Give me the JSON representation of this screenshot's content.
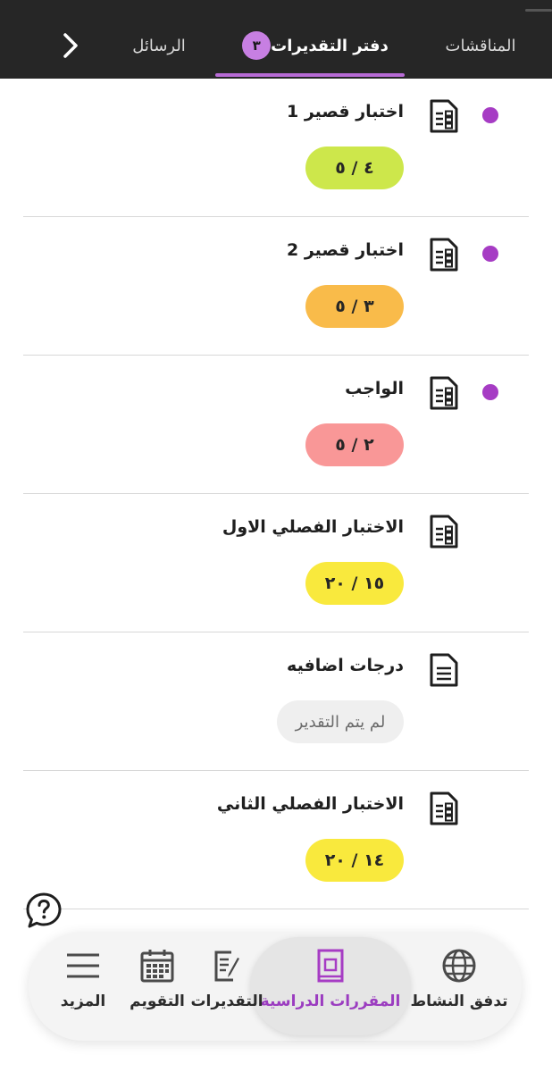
{
  "tabs": {
    "discussions": "المناقشات",
    "gradebook": "دفتر التقديرات",
    "gradebook_badge": "٣",
    "messages": "الرسائل"
  },
  "grades": [
    {
      "title": "اختبار قصير 1",
      "score": "٤ / ٥",
      "color": "#cde74b",
      "unread": true,
      "ungraded": false
    },
    {
      "title": "اختبار قصير 2",
      "score": "٣ / ٥",
      "color": "#f9bb4a",
      "unread": true,
      "ungraded": false
    },
    {
      "title": "الواجب",
      "score": "٢ / ٥",
      "color": "#f99797",
      "unread": true,
      "ungraded": false
    },
    {
      "title": "الاختبار الفصلي الاول",
      "score": "١٥ / ٢٠",
      "color": "#f9e93d",
      "unread": false,
      "ungraded": false
    },
    {
      "title": "درجات اضافيه",
      "score": "لم يتم التقدير",
      "color": "#efefef",
      "unread": false,
      "ungraded": true
    },
    {
      "title": "الاختبار الفصلي الثاني",
      "score": "١٤ / ٢٠",
      "color": "#f9e93d",
      "unread": false,
      "ungraded": false
    }
  ],
  "bottom_nav": {
    "activity": "تدفق النشاط",
    "courses": "المقررات الدراسية",
    "grades": "التقديرات",
    "calendar": "التقويم",
    "more": "المزيد"
  },
  "colors": {
    "accent": "#a63cc4",
    "header_bg": "#262626"
  }
}
